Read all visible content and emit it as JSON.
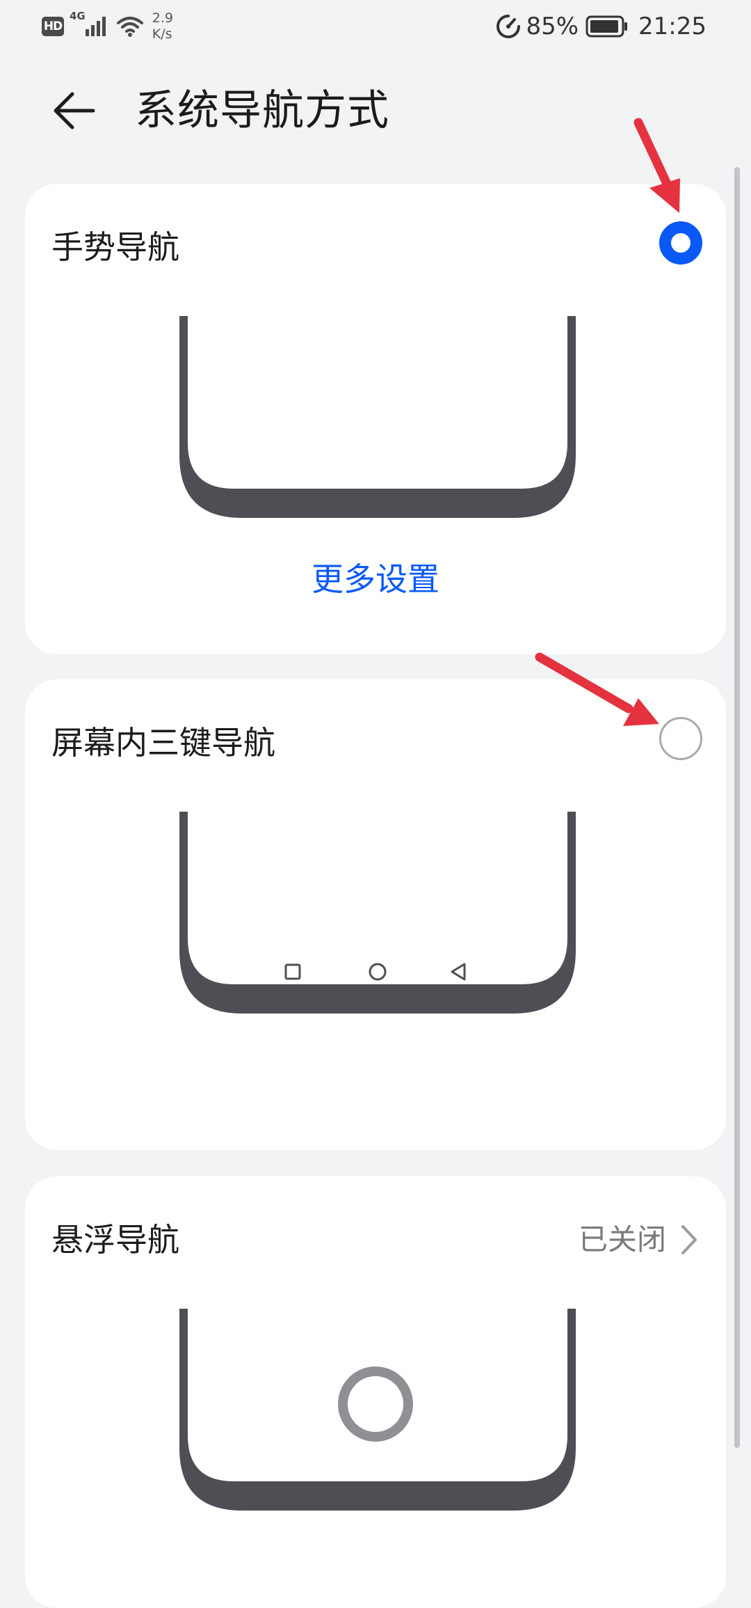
{
  "status_bar": {
    "hd": "HD",
    "network": "4G",
    "speed_value": "2.9",
    "speed_unit": "K/s",
    "battery_percent": "85%",
    "time": "21:25",
    "icons": [
      "hd-icon",
      "signal-icon",
      "wifi-icon",
      "data-saver-icon",
      "battery-icon"
    ]
  },
  "header": {
    "title": "系统导航方式",
    "back_icon": "back-arrow-icon"
  },
  "options": [
    {
      "title": "手势导航",
      "selected": true,
      "link": "更多设置",
      "illustration": "gesture-phone-illustration"
    },
    {
      "title": "屏幕内三键导航",
      "selected": false,
      "illustration": "three-key-phone-illustration",
      "nav_keys": [
        "square-key-icon",
        "circle-key-icon",
        "triangle-back-key-icon"
      ]
    },
    {
      "title": "悬浮导航",
      "status": "已关闭",
      "illustration": "floating-dock-phone-illustration"
    }
  ],
  "colors": {
    "accent": "#0a59f7",
    "background": "#f1f3f5",
    "card": "#ffffff",
    "phone_frame": "#4d4f55",
    "annotation_arrow": "#e5323f"
  }
}
